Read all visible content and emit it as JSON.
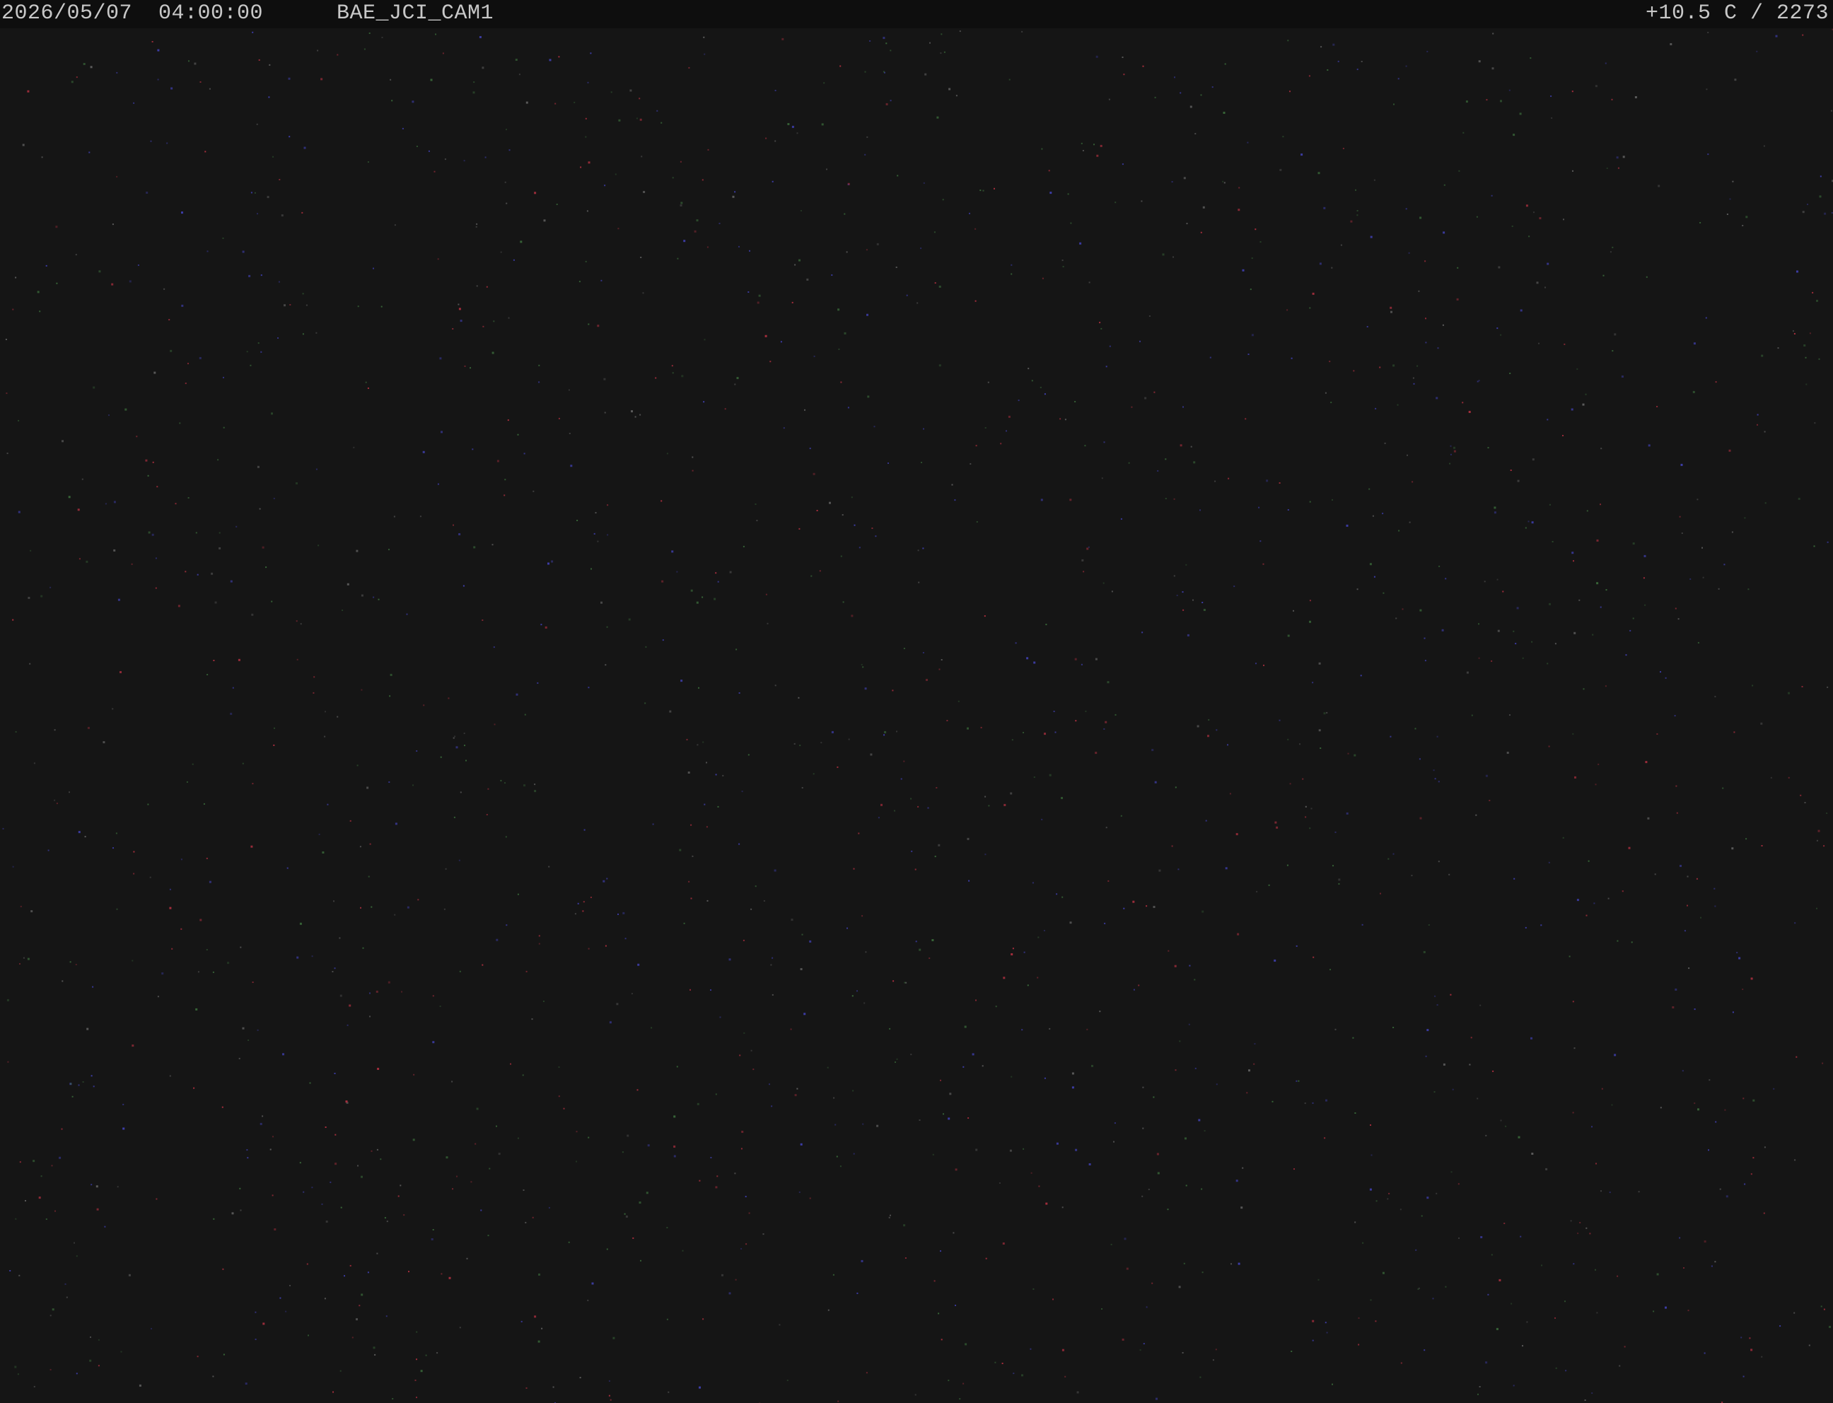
{
  "overlay": {
    "timestamp": "2026/05/07  04:00:00",
    "camera_id": "BAE_JCI_CAM1",
    "reading": "+10.5 C / 2273"
  },
  "scene": {
    "background_color": "#151515",
    "noise_colors": [
      "#b03040",
      "#3a6a3a",
      "#4040b0",
      "#606060"
    ]
  }
}
